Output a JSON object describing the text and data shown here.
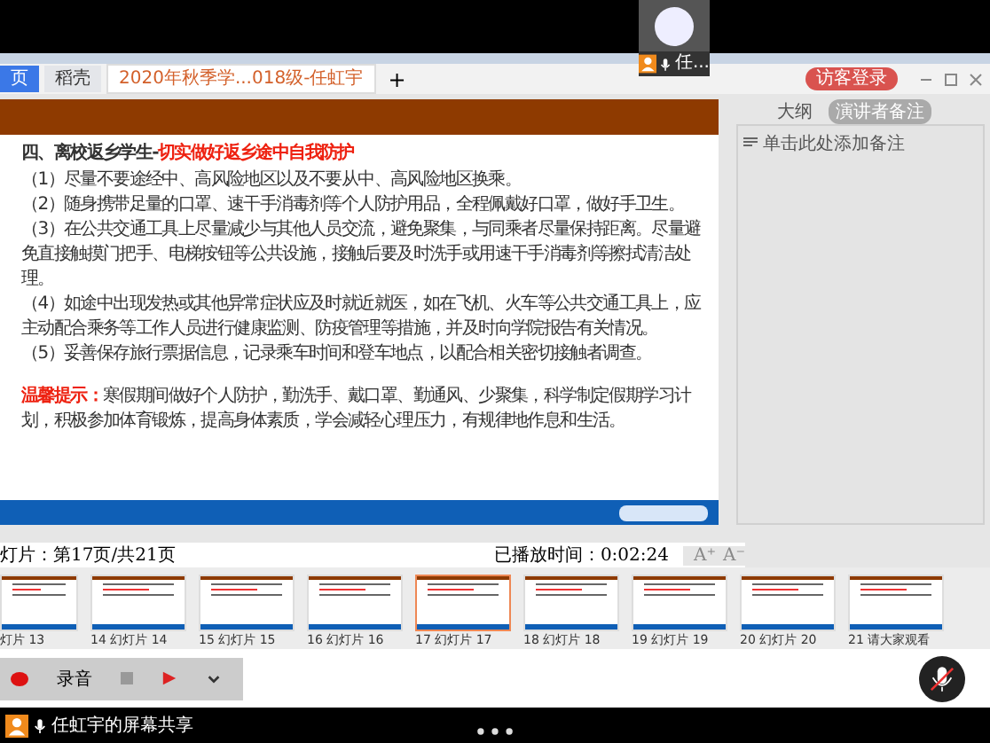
{
  "video_tile": {
    "name": "任..."
  },
  "tabs": [
    {
      "label": "页",
      "selected": false
    },
    {
      "label": "稻壳",
      "selected": false
    },
    {
      "label": "2020年秋季学...018级-任虹宇",
      "selected": true
    }
  ],
  "new_tab_button": "+",
  "login_button": "访客登录",
  "slide": {
    "heading": "四、离校返乡学生-",
    "heading_highlight": "切实做好返乡途中自我防护",
    "paragraphs": [
      "（1）尽量不要途经中、高风险地区以及不要从中、高风险地区换乘。",
      "（2）随身携带足量的口罩、速干手消毒剂等个人防护用品，全程佩戴好口罩，做好手卫生。",
      "（3）在公共交通工具上尽量减少与其他人员交流，避免聚集，与同乘者尽量保持距离。尽量避免直接触摸门把手、电梯按钮等公共设施，接触后要及时洗手或用速干手消毒剂等擦拭清洁处理。",
      "（4）如途中出现发热或其他异常症状应及时就近就医，如在飞机、火车等公共交通工具上，应主动配合乘务等工作人员进行健康监测、防疫管理等措施，并及时向学院报告有关情况。",
      "（5）妥善保存旅行票据信息，记录乘车时间和登车地点，以配合相关密切接触者调查。"
    ],
    "tip_label": "温馨提示：",
    "tip_text": "寒假期间做好个人防护，勤洗手、戴口罩、勤通风、少聚集，科学制定假期学习计划，积极参加体育锻炼，提高身体素质，学会减轻心理压力，有规律地作息和生活。"
  },
  "notes_panel": {
    "tabs": [
      {
        "label": "大纲",
        "selected": false
      },
      {
        "label": "演讲者备注",
        "selected": true
      }
    ],
    "placeholder": "单击此处添加备注"
  },
  "status": {
    "page": "灯片：第17页/共21页",
    "time": "已播放时间：0:02:24",
    "font_buttons": [
      "A⁺",
      "A⁻"
    ]
  },
  "thumbnails": [
    {
      "label": "灯片 13",
      "selected": false
    },
    {
      "label": "14 幻灯片 14",
      "selected": false
    },
    {
      "label": "15 幻灯片 15",
      "selected": false
    },
    {
      "label": "16 幻灯片 16",
      "selected": false
    },
    {
      "label": "17 幻灯片 17",
      "selected": true
    },
    {
      "label": "18 幻灯片 18",
      "selected": false
    },
    {
      "label": "19 幻灯片 19",
      "selected": false
    },
    {
      "label": "20 幻灯片 20",
      "selected": false
    },
    {
      "label": "21 请大家观看",
      "selected": false
    }
  ],
  "recorder": {
    "label": "录音"
  },
  "share_bar": {
    "title": "任虹宇的屏幕共享"
  }
}
